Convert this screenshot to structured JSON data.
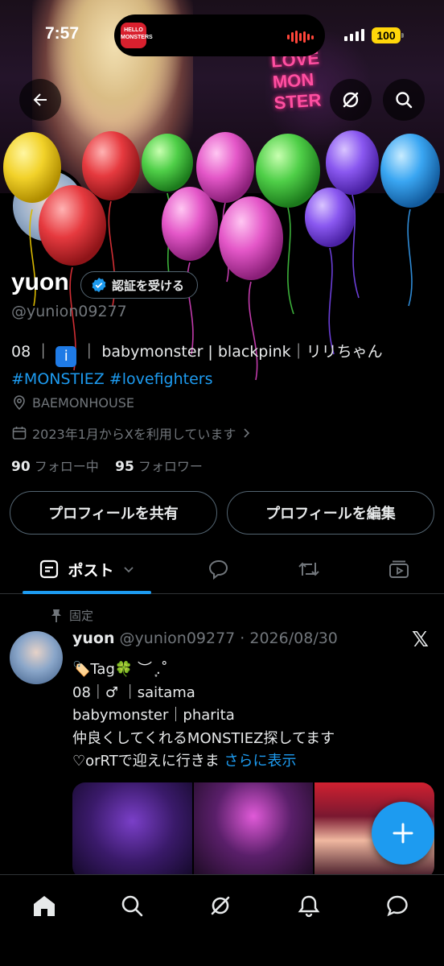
{
  "status_bar": {
    "time": "7:57",
    "battery": "100",
    "live_app_label": "HELLO MONSTERS"
  },
  "banner": {
    "sign_lines": [
      "LOVE",
      "MON",
      "STER"
    ]
  },
  "profile": {
    "name": "yuon",
    "verify_button": "認証を受ける",
    "handle": "@yunion09277",
    "bio_line1_prefix": "08 ｜",
    "bio_line1_suffix": "｜ babymonster | blackpink｜リリちゃん",
    "bio_hashtags": "#MONSTIEZ #lovefighters",
    "location": "BAEMONHOUSE",
    "joined": "2023年1月からXを利用しています",
    "following_count": "90",
    "following_label": "フォロー中",
    "followers_count": "95",
    "followers_label": "フォロワー",
    "share_button": "プロフィールを共有",
    "edit_button": "プロフィールを編集"
  },
  "tabs": {
    "posts_label": "ポスト"
  },
  "pinned_post": {
    "pinned_label": "固定",
    "author_name": "yuon",
    "author_meta": "@yunion09277 · 2026/08/30",
    "lines": [
      "🏷️Tag🍀 ︶ ͙.˚",
      "08｜♂ ｜saitama",
      "babymonster｜pharita",
      "仲良くしてくれるMONSTIEZ探してます",
      "♡orRTで迎えに行きま"
    ],
    "show_more": "さらに表示"
  },
  "colors": {
    "accent": "#1d9bf0",
    "background": "#000000",
    "muted_text": "#71767b",
    "border": "#536471"
  },
  "icons": {
    "back": "back-arrow-icon",
    "grok": "grok-icon",
    "search": "search-icon",
    "home": "home-icon",
    "notifications": "bell-icon",
    "messages": "message-icon"
  }
}
